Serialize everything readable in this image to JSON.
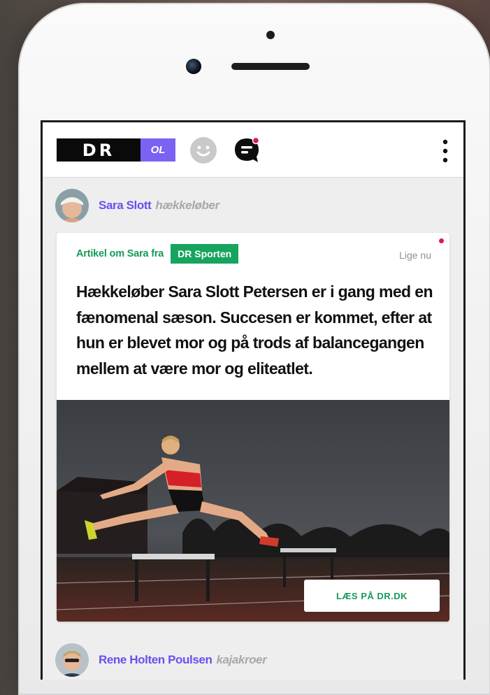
{
  "app": {
    "logo_text": "DR",
    "logo_badge": "OL",
    "icons": [
      "smiley-icon",
      "chat-icon",
      "more-vertical-icon"
    ],
    "colors": {
      "brand_purple": "#7b62f2",
      "green": "#16a45e",
      "notification": "#e0155d"
    }
  },
  "feed": {
    "posts": [
      {
        "athlete_name": "Sara Slott",
        "athlete_role": "hækkeløber",
        "source_label": "Artikel om Sara fra",
        "source_tag": "DR Sporten",
        "time": "Lige nu",
        "headline": "Hækkeløber Sara Slott Petersen er i gang med en fænomenal sæson. Succesen er kommet, efter at hun er blevet mor og på trods af balancegangen mellem at være mor og eliteatlet.",
        "button_label": "LÆS PÅ DR.DK"
      },
      {
        "athlete_name": "Rene Holten Poulsen",
        "athlete_role": "kajakroer"
      }
    ]
  }
}
